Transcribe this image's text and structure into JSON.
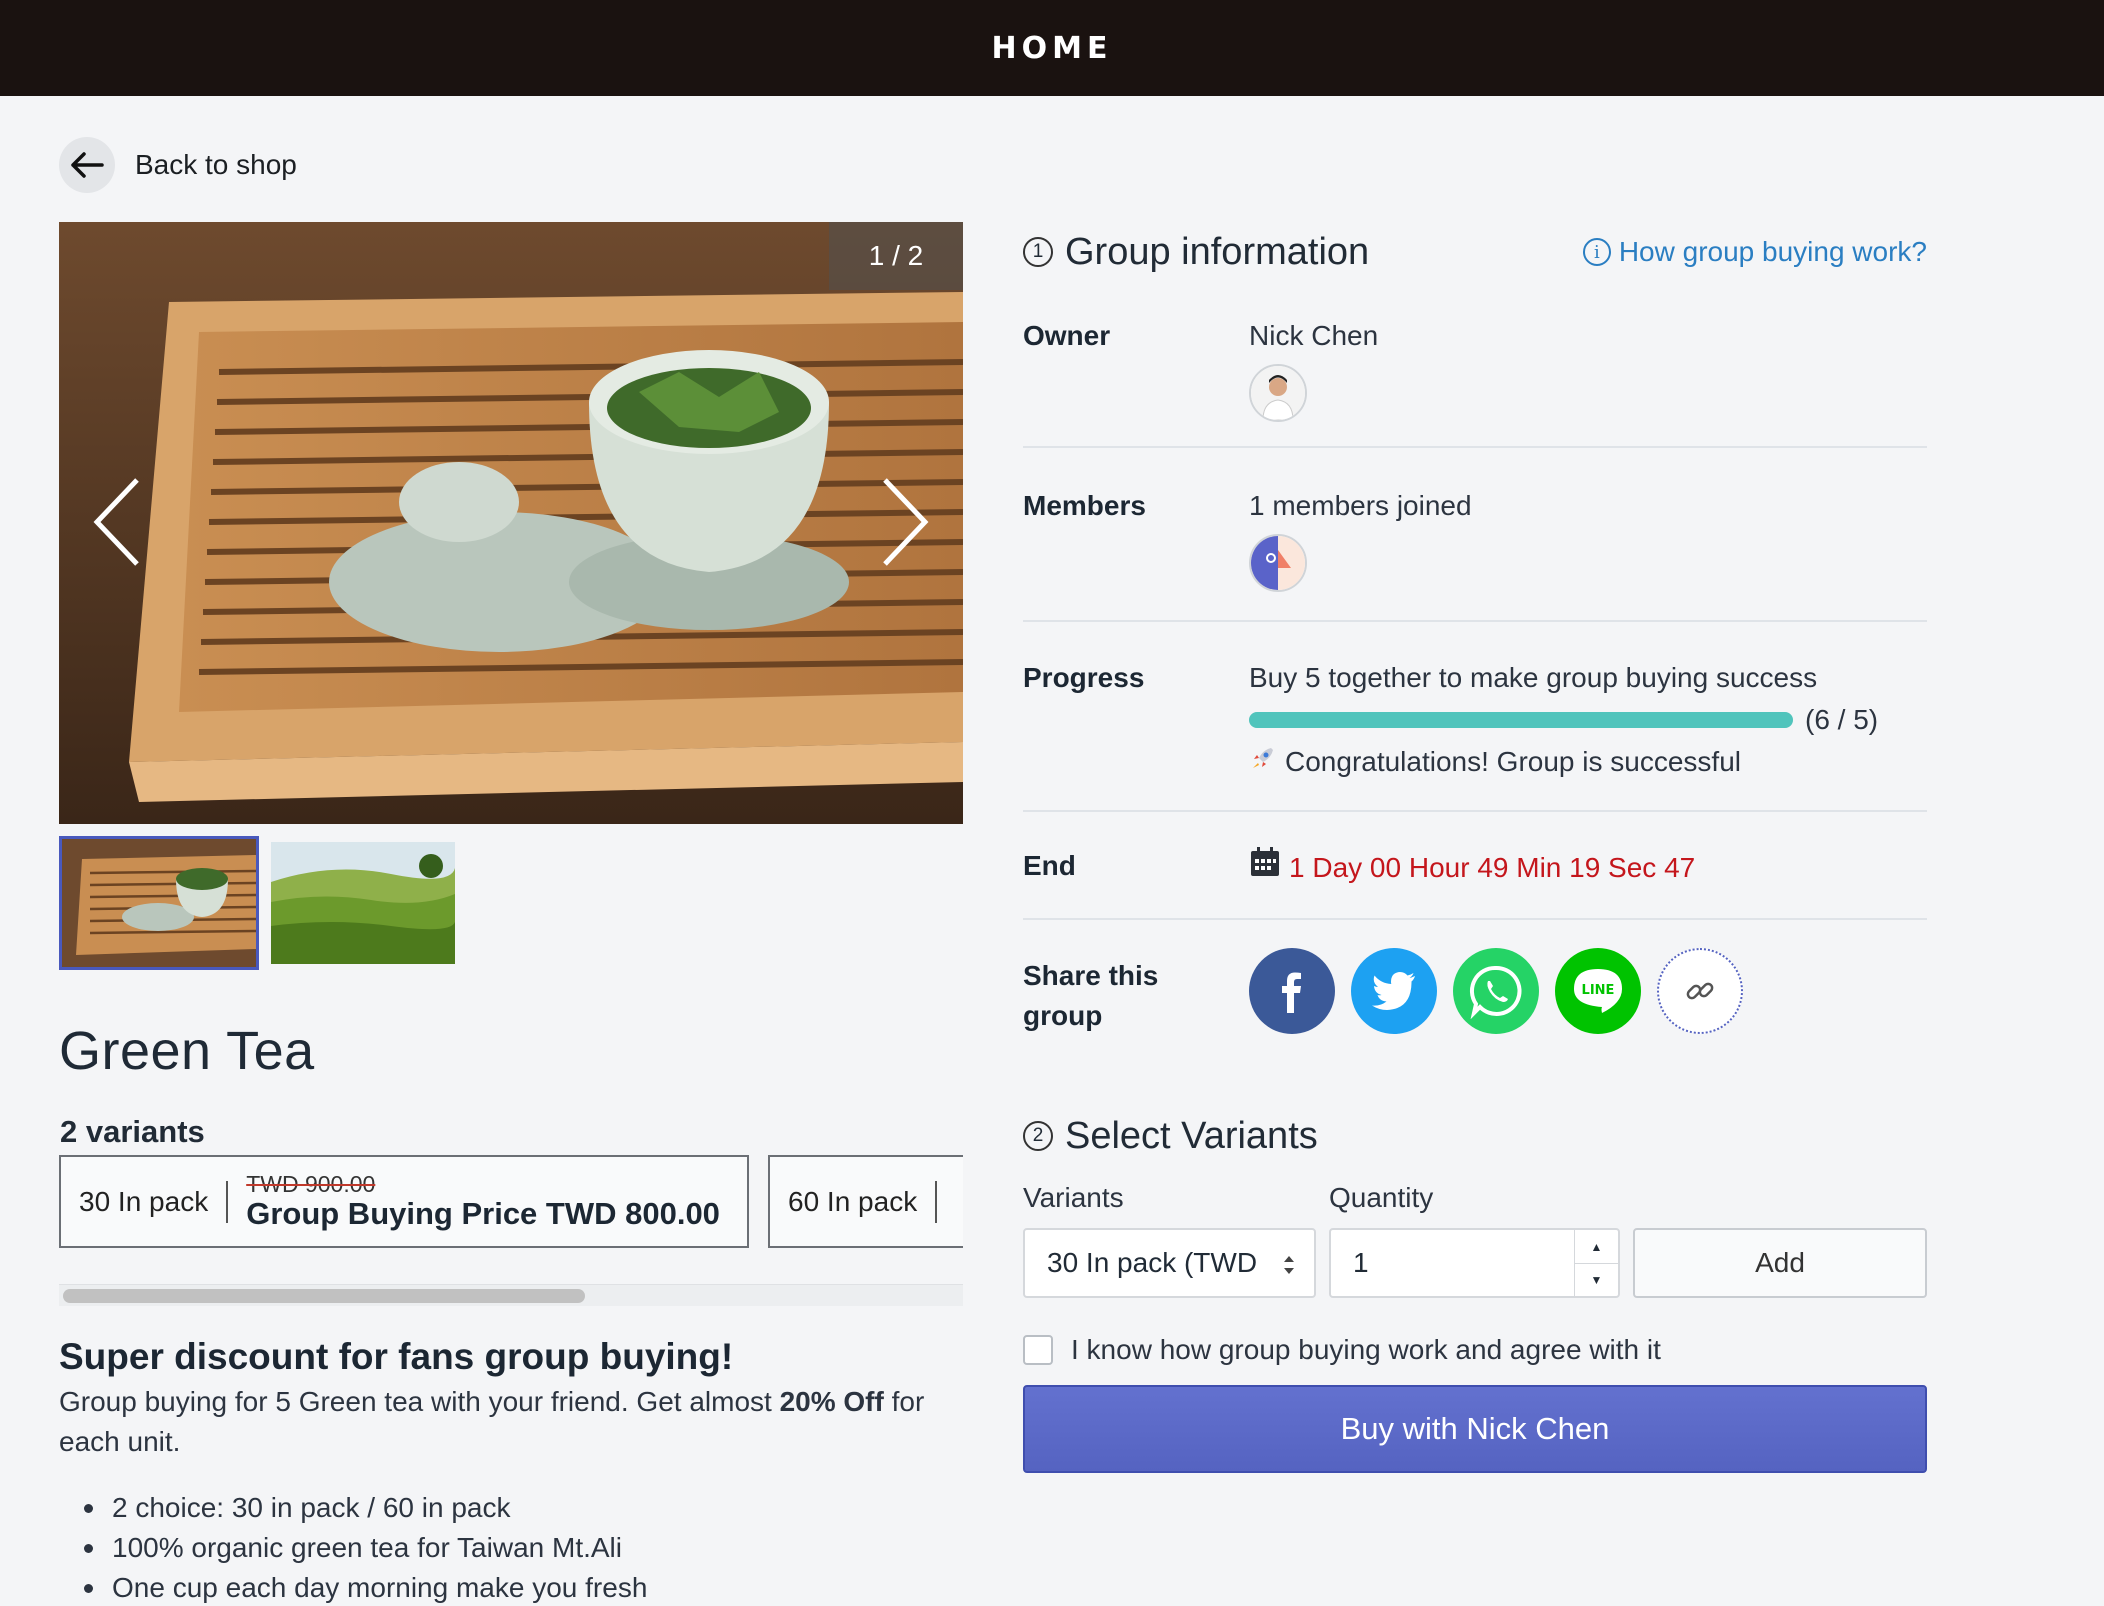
{
  "header": {
    "title": "HOME"
  },
  "back": {
    "label": "Back to shop"
  },
  "gallery": {
    "counter": "1 / 2"
  },
  "product": {
    "title": "Green Tea",
    "variants_count": "2 variants",
    "variants": [
      {
        "pack": "30 In pack",
        "old_price": "TWD 900.00",
        "group_price": "Group Buying Price TWD 800.00"
      },
      {
        "pack": "60 In pack"
      }
    ]
  },
  "description": {
    "title": "Super discount for fans group buying!",
    "body_1": "Group buying for 5 Green tea with your friend. Get almost ",
    "body_bold": "20% Off",
    "body_2": " for each unit.",
    "bullets": [
      "2 choice: 30 in pack / 60 in pack",
      "100% organic green tea for Taiwan Mt.Ali",
      "One cup each day morning make you fresh"
    ]
  },
  "group_info": {
    "step": "1",
    "title": "Group information",
    "how_link": "How group buying work?",
    "owner_label": "Owner",
    "owner_name": "Nick Chen",
    "members_label": "Members",
    "members_text": "1 members joined",
    "progress_label": "Progress",
    "progress_text": "Buy 5 together to make group buying success",
    "progress_count": "(6 / 5)",
    "progress_fraction": 1.0,
    "progress_success": "Congratulations! Group is successful",
    "end_label": "End",
    "countdown": "1 Day 00 Hour 49 Min 19 Sec 47",
    "share_label": "Share this group",
    "share_buttons": [
      "facebook-icon",
      "twitter-icon",
      "whatsapp-icon",
      "line-icon",
      "link-icon"
    ]
  },
  "select_variants": {
    "step": "2",
    "title": "Select Variants",
    "variants_label": "Variants",
    "quantity_label": "Quantity",
    "selected_variant": "30 In pack (TWD",
    "quantity": "1",
    "add_label": "Add",
    "agree_text": "I know how group buying work and agree with it",
    "buy_label": "Buy with Nick Chen"
  },
  "colors": {
    "header_bg": "#1a1210",
    "accent": "#5563c1",
    "link": "#2a7ec2",
    "progress": "#50c4bc",
    "countdown": "#c4161c",
    "facebook": "#3b5998",
    "twitter": "#1da1f2",
    "whatsapp": "#25d366",
    "line": "#00c300"
  }
}
